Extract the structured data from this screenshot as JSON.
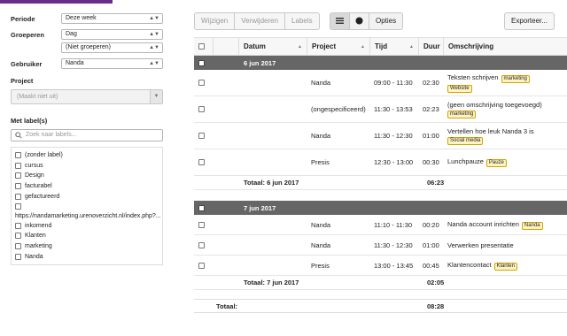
{
  "sidebar": {
    "periode_label": "Periode",
    "periode_value": "Deze week",
    "groeperen_label": "Groeperen",
    "groeperen_value1": "Dag",
    "groeperen_value2": "(Niet groeperen)",
    "gebruiker_label": "Gebruiker",
    "gebruiker_value": "Nanda",
    "project_label": "Project",
    "project_placeholder": "(Maakt niet uit)",
    "labels_label": "Met label(s)",
    "search_placeholder": "Zoek naar labels...",
    "labels": [
      "(zonder label)",
      "cursus",
      "Design",
      "facturabel",
      "gefactureerd"
    ],
    "url_label": "https://nandamarketing.urenoverzicht.nl/index.php?...",
    "labels2": [
      "inkomend",
      "Klanten",
      "marketing",
      "Nanda"
    ]
  },
  "toolbar": {
    "edit": "Wijzigen",
    "delete": "Verwijderen",
    "labels": "Labels",
    "options": "Opties",
    "export": "Exporteer..."
  },
  "table": {
    "headers": {
      "datum": "Datum",
      "project": "Project",
      "tijd": "Tijd",
      "duur": "Duur",
      "omschrijving": "Omschrijving"
    },
    "day1": {
      "date": "6 jun 2017",
      "rows": [
        {
          "project": "Nanda",
          "tijd": "09:00 - 11:30",
          "duur": "02:30",
          "oms": "Teksten schrijven",
          "tag_inline": "marketing",
          "tag_below": "Website"
        },
        {
          "project": "(ongespecificeerd)",
          "tijd": "11:30 - 13:53",
          "duur": "02:23",
          "oms": "(geen omschrijving toegevoegd)",
          "tag_inline": "",
          "tag_below": "marketing"
        },
        {
          "project": "Nanda",
          "tijd": "11:30 - 12:30",
          "duur": "01:00",
          "oms": "Vertellen hoe leuk Nanda 3 is",
          "tag_inline": "",
          "tag_below": "Social media"
        },
        {
          "project": "Presis",
          "tijd": "12:30 - 13:00",
          "duur": "00:30",
          "oms": "Lunchpauze",
          "tag_inline": "Pauze",
          "tag_below": ""
        }
      ],
      "total_label": "Totaal: 6 jun 2017",
      "total": "06:23"
    },
    "day2": {
      "date": "7 jun 2017",
      "rows": [
        {
          "project": "Nanda",
          "tijd": "11:10 - 11:30",
          "duur": "00:20",
          "oms": "Nanda account inrichten",
          "tag_inline": "Nanda",
          "tag_below": ""
        },
        {
          "project": "Nanda",
          "tijd": "11:30 - 12:30",
          "duur": "01:00",
          "oms": "Verwerken presentatie",
          "tag_inline": "",
          "tag_below": ""
        },
        {
          "project": "Presis",
          "tijd": "13:00 - 13:45",
          "duur": "00:45",
          "oms": "Klantencontact",
          "tag_inline": "Klanten",
          "tag_below": ""
        }
      ],
      "total_label": "Totaal: 7 jun 2017",
      "total": "02:05"
    },
    "grand_label": "Totaal:",
    "grand_total": "08:28"
  }
}
